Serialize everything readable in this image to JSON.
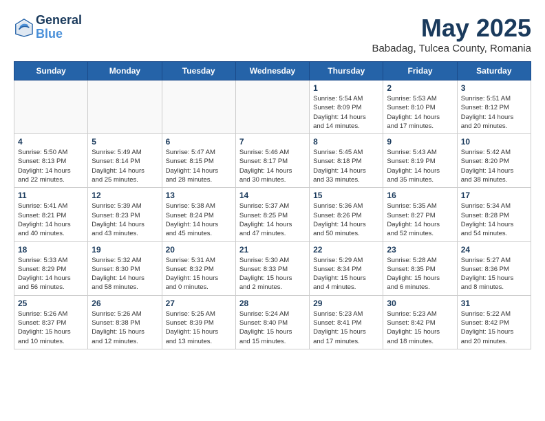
{
  "logo": {
    "line1": "General",
    "line2": "Blue"
  },
  "title": "May 2025",
  "subtitle": "Babadag, Tulcea County, Romania",
  "days_header": [
    "Sunday",
    "Monday",
    "Tuesday",
    "Wednesday",
    "Thursday",
    "Friday",
    "Saturday"
  ],
  "weeks": [
    [
      {
        "num": "",
        "info": ""
      },
      {
        "num": "",
        "info": ""
      },
      {
        "num": "",
        "info": ""
      },
      {
        "num": "",
        "info": ""
      },
      {
        "num": "1",
        "info": "Sunrise: 5:54 AM\nSunset: 8:09 PM\nDaylight: 14 hours\nand 14 minutes."
      },
      {
        "num": "2",
        "info": "Sunrise: 5:53 AM\nSunset: 8:10 PM\nDaylight: 14 hours\nand 17 minutes."
      },
      {
        "num": "3",
        "info": "Sunrise: 5:51 AM\nSunset: 8:12 PM\nDaylight: 14 hours\nand 20 minutes."
      }
    ],
    [
      {
        "num": "4",
        "info": "Sunrise: 5:50 AM\nSunset: 8:13 PM\nDaylight: 14 hours\nand 22 minutes."
      },
      {
        "num": "5",
        "info": "Sunrise: 5:49 AM\nSunset: 8:14 PM\nDaylight: 14 hours\nand 25 minutes."
      },
      {
        "num": "6",
        "info": "Sunrise: 5:47 AM\nSunset: 8:15 PM\nDaylight: 14 hours\nand 28 minutes."
      },
      {
        "num": "7",
        "info": "Sunrise: 5:46 AM\nSunset: 8:17 PM\nDaylight: 14 hours\nand 30 minutes."
      },
      {
        "num": "8",
        "info": "Sunrise: 5:45 AM\nSunset: 8:18 PM\nDaylight: 14 hours\nand 33 minutes."
      },
      {
        "num": "9",
        "info": "Sunrise: 5:43 AM\nSunset: 8:19 PM\nDaylight: 14 hours\nand 35 minutes."
      },
      {
        "num": "10",
        "info": "Sunrise: 5:42 AM\nSunset: 8:20 PM\nDaylight: 14 hours\nand 38 minutes."
      }
    ],
    [
      {
        "num": "11",
        "info": "Sunrise: 5:41 AM\nSunset: 8:21 PM\nDaylight: 14 hours\nand 40 minutes."
      },
      {
        "num": "12",
        "info": "Sunrise: 5:39 AM\nSunset: 8:23 PM\nDaylight: 14 hours\nand 43 minutes."
      },
      {
        "num": "13",
        "info": "Sunrise: 5:38 AM\nSunset: 8:24 PM\nDaylight: 14 hours\nand 45 minutes."
      },
      {
        "num": "14",
        "info": "Sunrise: 5:37 AM\nSunset: 8:25 PM\nDaylight: 14 hours\nand 47 minutes."
      },
      {
        "num": "15",
        "info": "Sunrise: 5:36 AM\nSunset: 8:26 PM\nDaylight: 14 hours\nand 50 minutes."
      },
      {
        "num": "16",
        "info": "Sunrise: 5:35 AM\nSunset: 8:27 PM\nDaylight: 14 hours\nand 52 minutes."
      },
      {
        "num": "17",
        "info": "Sunrise: 5:34 AM\nSunset: 8:28 PM\nDaylight: 14 hours\nand 54 minutes."
      }
    ],
    [
      {
        "num": "18",
        "info": "Sunrise: 5:33 AM\nSunset: 8:29 PM\nDaylight: 14 hours\nand 56 minutes."
      },
      {
        "num": "19",
        "info": "Sunrise: 5:32 AM\nSunset: 8:30 PM\nDaylight: 14 hours\nand 58 minutes."
      },
      {
        "num": "20",
        "info": "Sunrise: 5:31 AM\nSunset: 8:32 PM\nDaylight: 15 hours\nand 0 minutes."
      },
      {
        "num": "21",
        "info": "Sunrise: 5:30 AM\nSunset: 8:33 PM\nDaylight: 15 hours\nand 2 minutes."
      },
      {
        "num": "22",
        "info": "Sunrise: 5:29 AM\nSunset: 8:34 PM\nDaylight: 15 hours\nand 4 minutes."
      },
      {
        "num": "23",
        "info": "Sunrise: 5:28 AM\nSunset: 8:35 PM\nDaylight: 15 hours\nand 6 minutes."
      },
      {
        "num": "24",
        "info": "Sunrise: 5:27 AM\nSunset: 8:36 PM\nDaylight: 15 hours\nand 8 minutes."
      }
    ],
    [
      {
        "num": "25",
        "info": "Sunrise: 5:26 AM\nSunset: 8:37 PM\nDaylight: 15 hours\nand 10 minutes."
      },
      {
        "num": "26",
        "info": "Sunrise: 5:26 AM\nSunset: 8:38 PM\nDaylight: 15 hours\nand 12 minutes."
      },
      {
        "num": "27",
        "info": "Sunrise: 5:25 AM\nSunset: 8:39 PM\nDaylight: 15 hours\nand 13 minutes."
      },
      {
        "num": "28",
        "info": "Sunrise: 5:24 AM\nSunset: 8:40 PM\nDaylight: 15 hours\nand 15 minutes."
      },
      {
        "num": "29",
        "info": "Sunrise: 5:23 AM\nSunset: 8:41 PM\nDaylight: 15 hours\nand 17 minutes."
      },
      {
        "num": "30",
        "info": "Sunrise: 5:23 AM\nSunset: 8:42 PM\nDaylight: 15 hours\nand 18 minutes."
      },
      {
        "num": "31",
        "info": "Sunrise: 5:22 AM\nSunset: 8:42 PM\nDaylight: 15 hours\nand 20 minutes."
      }
    ]
  ]
}
